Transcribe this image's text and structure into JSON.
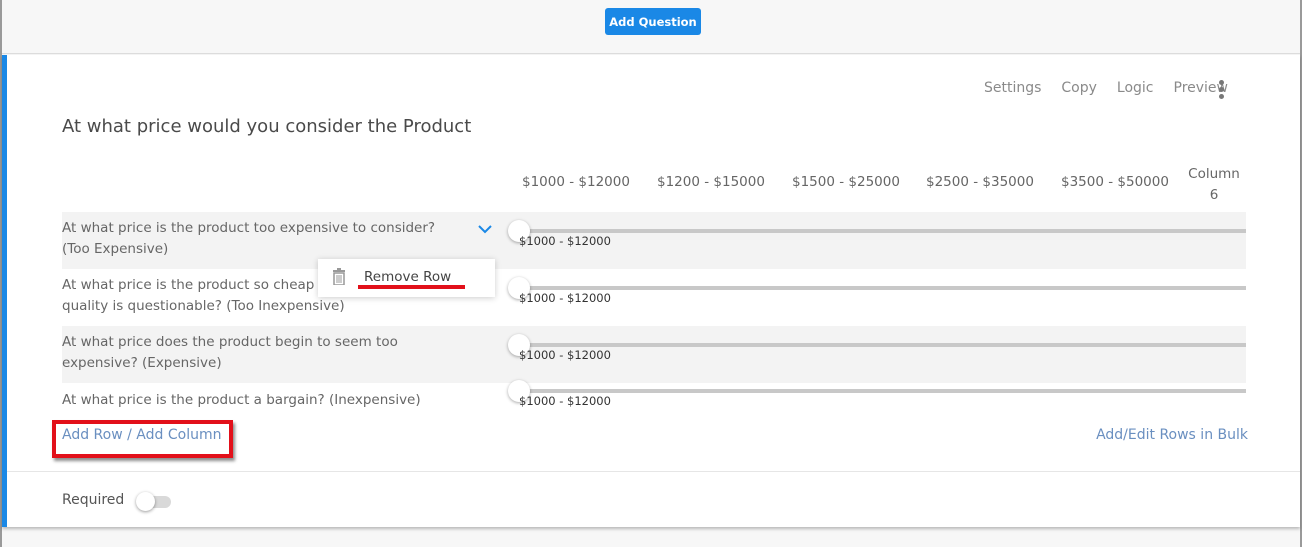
{
  "toolbar": {
    "add_question_label": "Add Question"
  },
  "card": {
    "actions": [
      "Settings",
      "Copy",
      "Logic",
      "Preview"
    ],
    "title": "At what price would you consider the Product",
    "columns": [
      "$1000 - $12000",
      "$1200 - $15000",
      "$1500 - $25000",
      "$2500 - $35000",
      "$3500 - $50000",
      "Column 6"
    ],
    "rows": [
      {
        "label": "At what price is the product too expensive to consider? (Too Expensive)",
        "slider_value": "$1000 - $12000",
        "slider_position": 0
      },
      {
        "label": "At what price is the product so cheap that quality is questionable? (Too Inexpensive)",
        "label_visible": "At what price is the product so cheap",
        "label_line2": "quality is questionable? (Too Inexpensive)",
        "slider_value": "$1000 - $12000",
        "slider_position": 0
      },
      {
        "label": "At what price does the product begin to seem too expensive? (Expensive)",
        "slider_value": "$1000 - $12000",
        "slider_position": 0
      },
      {
        "label": "At what price is the product a bargain? (Inexpensive)",
        "slider_value": "$1000 - $12000",
        "slider_position": 0
      }
    ],
    "row_menu": {
      "remove_row_label": "Remove Row"
    },
    "add_row_label": "Add Row",
    "separator": "/",
    "add_column_label": "Add Column",
    "bulk_label": "Add/Edit Rows in Bulk",
    "required_label": "Required",
    "required_on": false
  },
  "colors": {
    "accent": "#1a88e6",
    "annotation": "#e2101a",
    "link": "#6a8fc0"
  }
}
